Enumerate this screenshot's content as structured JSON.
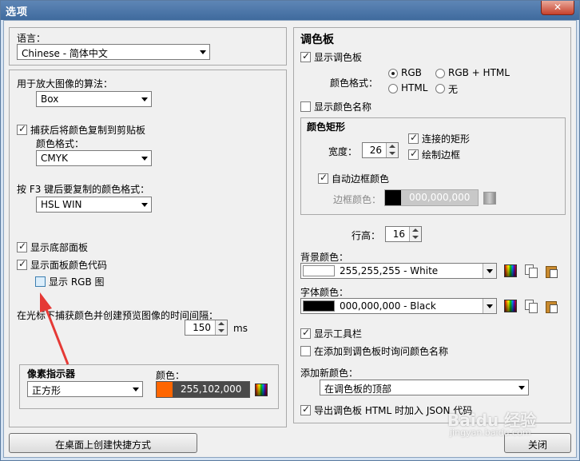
{
  "window": {
    "title": "选项",
    "close": "✕"
  },
  "left": {
    "language_label": "语言：",
    "language_value": "Chinese - 简体中文",
    "algo_label": "用于放大图像的算法：",
    "algo_value": "Box",
    "copy_clipboard": "捕获后将颜色复制到剪贴板",
    "color_format_label": "颜色格式：",
    "color_format_value": "CMYK",
    "f3_label": "按 F3 键后要复制的颜色格式：",
    "f3_value": "HSL WIN",
    "show_bottom": "显示底部面板",
    "show_codes": "显示面板颜色代码",
    "show_rgb": "显示 RGB 图",
    "interval_label": "在光标下捕获颜色并创建预览图像的时间间隔：",
    "interval_value": "150",
    "interval_unit": "ms",
    "pixel_title": "像素指示器",
    "shape_value": "正方形",
    "pixel_color_label": "颜色：",
    "pixel_color_value": "255,102,000",
    "pixel_color_hex": "#ff6600",
    "shortcut_button": "在桌面上创建快捷方式"
  },
  "right": {
    "title": "调色板",
    "show_palette": "显示调色板",
    "format_label": "颜色格式：",
    "radio_rgb": "RGB",
    "radio_rgb_html": "RGB + HTML",
    "radio_html": "HTML",
    "radio_none": "无",
    "show_names": "显示颜色名称",
    "matrix_title": "颜色矩形",
    "width_label": "宽度：",
    "width_value": "26",
    "connected": "连接的矩形",
    "draw_border": "绘制边框",
    "auto_border": "自动边框颜色",
    "border_color_label": "边框颜色：",
    "border_color_value": "000,000,000",
    "row_height_label": "行高：",
    "row_height_value": "16",
    "bg_label": "背景颜色：",
    "bg_value": "255,255,255 - White",
    "bg_hex": "#ffffff",
    "font_label": "字体颜色：",
    "font_value": "000,000,000 - Black",
    "font_hex": "#000000",
    "show_toolbar": "显示工具栏",
    "ask_name": "在添加到调色板时询问颜色名称",
    "add_new_label": "添加新颜色：",
    "add_new_value": "在调色板的顶部",
    "export_json": "导出调色板 HTML 时加入 JSON 代码",
    "close_button": "关闭"
  },
  "watermark": {
    "brand": "Baidu 经验",
    "url": "jingyan.baidu.com"
  }
}
